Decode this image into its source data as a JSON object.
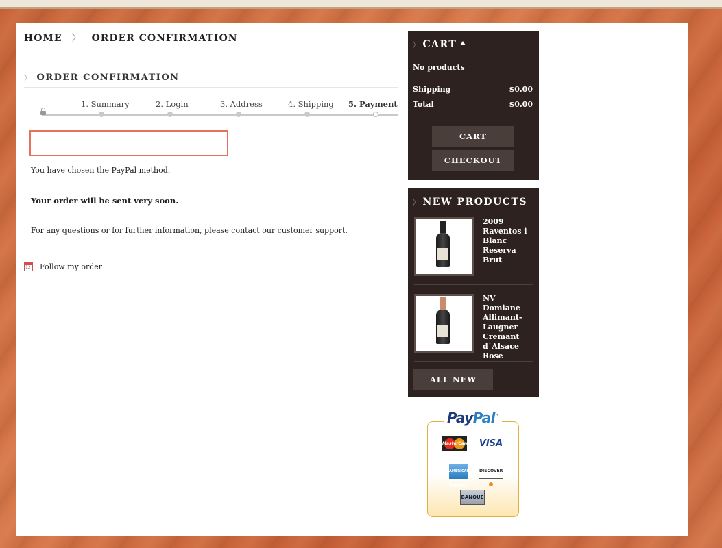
{
  "breadcrumb": {
    "home": "HOME",
    "separator": "〉",
    "current": "ORDER CONFIRMATION"
  },
  "page_title": "ORDER CONFIRMATION",
  "steps": [
    {
      "label": "1. Summary",
      "state": "done"
    },
    {
      "label": "2. Login",
      "state": "done"
    },
    {
      "label": "3. Address",
      "state": "done"
    },
    {
      "label": "4. Shipping",
      "state": "done"
    },
    {
      "label": "5. Payment",
      "state": "current"
    }
  ],
  "messages": {
    "paypal": "You have chosen the PayPal method.",
    "sent": "Your order will be sent very soon.",
    "support": "For any questions or for further information, please contact our customer support."
  },
  "follow_link": "Follow my order",
  "cart": {
    "title": "CART",
    "empty": "No products",
    "shipping_label": "Shipping",
    "shipping_value": "$0.00",
    "total_label": "Total",
    "total_value": "$0.00",
    "cart_button": "CART",
    "checkout_button": "CHECKOUT"
  },
  "new_products": {
    "title": "NEW PRODUCTS",
    "items": [
      {
        "name": "2009 Raventos i Blanc Reserva Brut"
      },
      {
        "name": "NV Domiane Allimant-Laugner Cremant d`Alsace Rose"
      }
    ],
    "all_new_button": "ALL NEW"
  },
  "paypal": {
    "logo_pay": "Pay",
    "logo_pal": "Pal",
    "tm": "™",
    "cards": [
      "MasterCard",
      "VISA",
      "AMERICAN EXPRESS",
      "DISCOVER",
      "BANQUE"
    ]
  },
  "colors": {
    "sidebar_bg": "#2e2220",
    "button_bg": "#4a3e3b",
    "alert_border": "#e9705b",
    "paypal_navy": "#1d3a7a",
    "paypal_blue": "#2b80c4"
  }
}
